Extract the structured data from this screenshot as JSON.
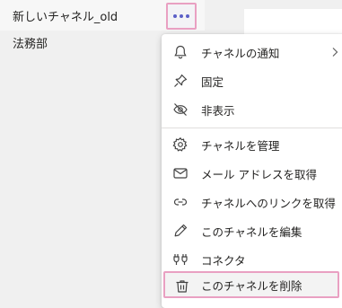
{
  "channels": [
    {
      "label": "新しいチャネル_old"
    },
    {
      "label": "法務部"
    }
  ],
  "more_button": {
    "icon": "more-horizontal-icon"
  },
  "context_menu": {
    "items": [
      {
        "label": "チャネルの通知",
        "icon": "bell-icon",
        "has_submenu": true
      },
      {
        "label": "固定",
        "icon": "pin-icon"
      },
      {
        "label": "非表示",
        "icon": "eye-off-icon"
      },
      {
        "label": "チャネルを管理",
        "icon": "gear-icon"
      },
      {
        "label": "メール アドレスを取得",
        "icon": "mail-icon"
      },
      {
        "label": "チャネルへのリンクを取得",
        "icon": "link-icon"
      },
      {
        "label": "このチャネルを編集",
        "icon": "pencil-icon"
      },
      {
        "label": "コネクタ",
        "icon": "connector-icon"
      },
      {
        "label": "このチャネルを削除",
        "icon": "trash-icon",
        "highlighted": true
      }
    ]
  },
  "colors": {
    "accent": "#5b5fc7",
    "highlight_border": "#e9a0c2",
    "menu_bg": "#ffffff",
    "sidebar_bg": "#f0f0f0"
  }
}
